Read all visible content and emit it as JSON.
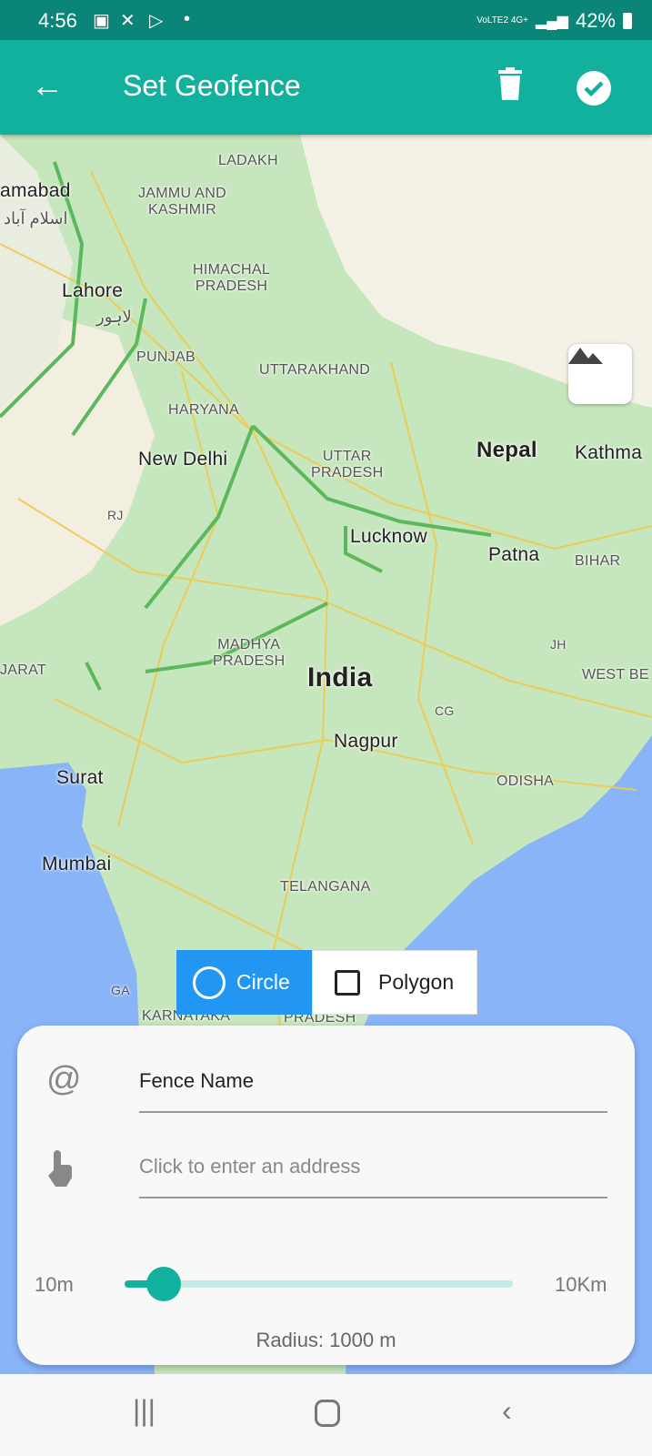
{
  "status_bar": {
    "time": "4:56",
    "network": "VoLTE2 4G+",
    "battery": "42%"
  },
  "app_bar": {
    "title": "Set Geofence",
    "back_icon": "arrow-left-icon",
    "delete_icon": "trash-icon",
    "confirm_icon": "check-circle-icon"
  },
  "map": {
    "labels": {
      "ladakh": "LADAKH",
      "jk": "JAMMU AND\nKASHMIR",
      "islamabad": "amabad",
      "islamabad_ur": "اسلام آباد",
      "lahore": "Lahore",
      "lahore_ur": "لاہور",
      "himachal": "HIMACHAL\nPRADESH",
      "punjab": "PUNJAB",
      "uttarakhand": "UTTARAKHAND",
      "haryana": "HARYANA",
      "newdelhi": "New Delhi",
      "up": "UTTAR\nPRADESH",
      "nepal": "Nepal",
      "kathmandu": "Kathma",
      "rj": "RJ",
      "lucknow": "Lucknow",
      "patna": "Patna",
      "bihar": "BIHAR",
      "mp": "MADHYA\nPRADESH",
      "jh": "JH",
      "westbengal": "WEST BE",
      "gujarat": "JARAT",
      "india": "India",
      "cg": "CG",
      "nagpur": "Nagpur",
      "surat": "Surat",
      "odisha": "ODISHA",
      "mumbai": "Mumbai",
      "telangana": "TELANGANA",
      "ga": "GA",
      "karnataka": "KARNATAKA",
      "ap": "PRADESH"
    },
    "terrain_button_icon": "mountain-icon",
    "colors": {
      "land": "#c6e6bd",
      "north": "#f4f1e6",
      "sea": "#8ab4f8",
      "roads": "#f2c94c",
      "highway": "#5cb85c"
    }
  },
  "shape_toggle": {
    "circle": "Circle",
    "polygon": "Polygon",
    "selected": "Circle"
  },
  "form": {
    "fence_name": "Fence Name",
    "address_placeholder": "Click to enter an address"
  },
  "slider": {
    "min_label": "10m",
    "max_label": "10Km",
    "min": 10,
    "max": 10000,
    "value": 1000,
    "fraction": 0.1,
    "radius_text": "Radius: 1000 m"
  },
  "accent": "#12b19d"
}
